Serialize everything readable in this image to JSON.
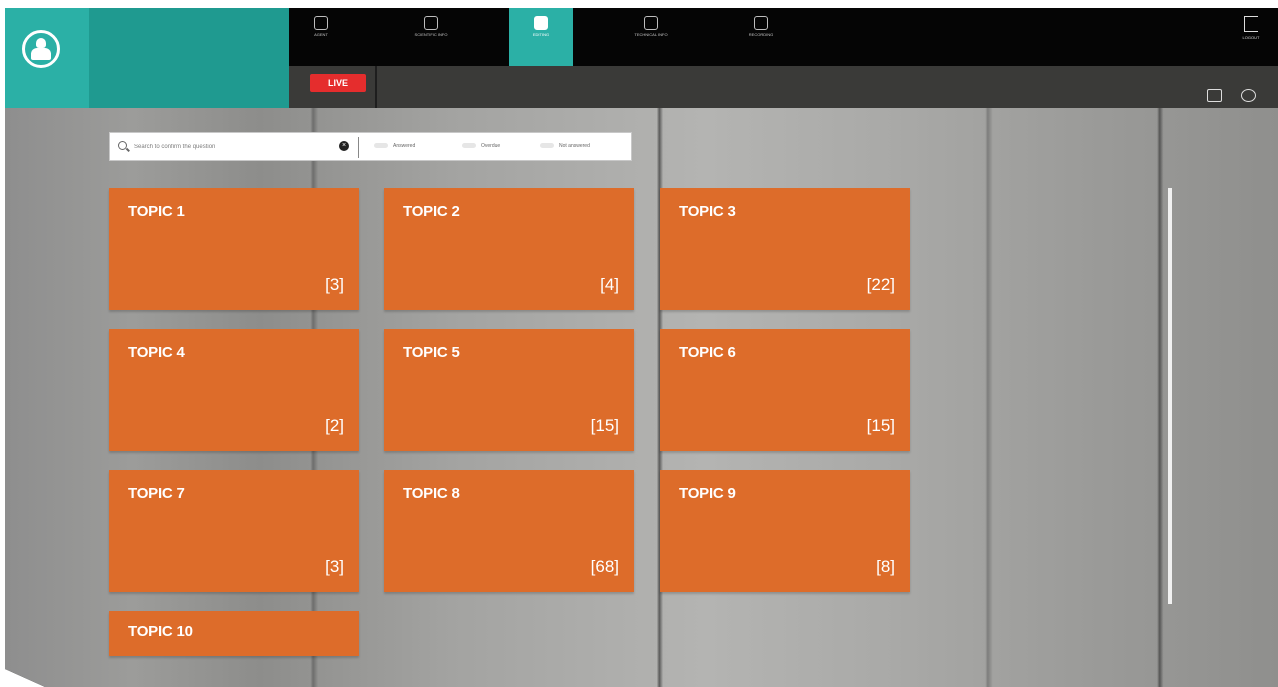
{
  "nav": {
    "items": [
      {
        "icon": "home-icon",
        "label": "AGENT"
      },
      {
        "icon": "bulb-icon",
        "label": "SCIENTIFIC INFO"
      },
      {
        "icon": "book-icon",
        "label": "EDITING"
      },
      {
        "icon": "phone-icon",
        "label": "TECHNICAL INFO"
      },
      {
        "icon": "camera-icon",
        "label": "RECORDING"
      }
    ],
    "active_index": 2,
    "logout_label": "LOGOUT"
  },
  "status": {
    "live_label": "LIVE"
  },
  "search": {
    "placeholder": "Search to confirm the question"
  },
  "legend": [
    {
      "label": "Answered"
    },
    {
      "label": "Overdue"
    },
    {
      "label": "Not answered"
    }
  ],
  "topics": [
    {
      "name": "TOPIC 1",
      "count": "[3]"
    },
    {
      "name": "TOPIC 2",
      "count": "[4]"
    },
    {
      "name": "TOPIC 3",
      "count": "[22]"
    },
    {
      "name": "TOPIC 4",
      "count": "[2]"
    },
    {
      "name": "TOPIC 5",
      "count": "[15]"
    },
    {
      "name": "TOPIC 6",
      "count": "[15]"
    },
    {
      "name": "TOPIC 7",
      "count": "[3]"
    },
    {
      "name": "TOPIC 8",
      "count": "[68]"
    },
    {
      "name": "TOPIC 9",
      "count": "[8]"
    },
    {
      "name": "TOPIC 10",
      "count": ""
    }
  ],
  "colors": {
    "tile": "#dd6c2a",
    "brand_teal": "#2bb0a6",
    "live_red": "#e52d2d"
  }
}
